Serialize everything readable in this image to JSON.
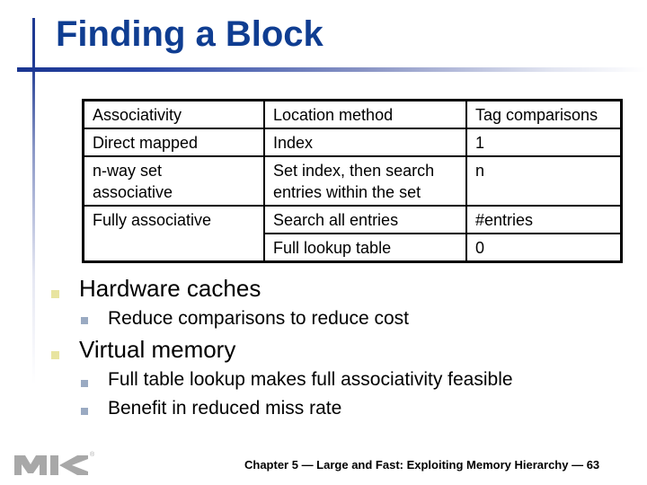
{
  "slide": {
    "title": "Finding a Block",
    "table": {
      "rows": [
        [
          "Associativity",
          "Location method",
          "Tag comparisons"
        ],
        [
          "Direct mapped",
          "Index",
          "1"
        ],
        [
          "n-way set\nassociative",
          "Set index, then search\nentries within the set",
          "n"
        ],
        [
          "Fully associative",
          "Search all entries",
          "#entries"
        ],
        [
          "",
          "Full lookup table",
          "0"
        ]
      ]
    },
    "bullets": [
      {
        "text": "Hardware caches",
        "sub": [
          "Reduce comparisons to reduce cost"
        ]
      },
      {
        "text": "Virtual memory",
        "sub": [
          "Full table lookup makes full associativity feasible",
          "Benefit in reduced miss rate"
        ]
      }
    ],
    "footer": "Chapter 5 — Large and Fast: Exploiting Memory Hierarchy — 63",
    "logo": {
      "text": "MK",
      "registered": "®"
    }
  },
  "colors": {
    "title": "#0f3d91",
    "bullet_level1": "#e8e4a0",
    "bullet_level2": "#9aaac2",
    "logo": "#a8a8a8"
  }
}
